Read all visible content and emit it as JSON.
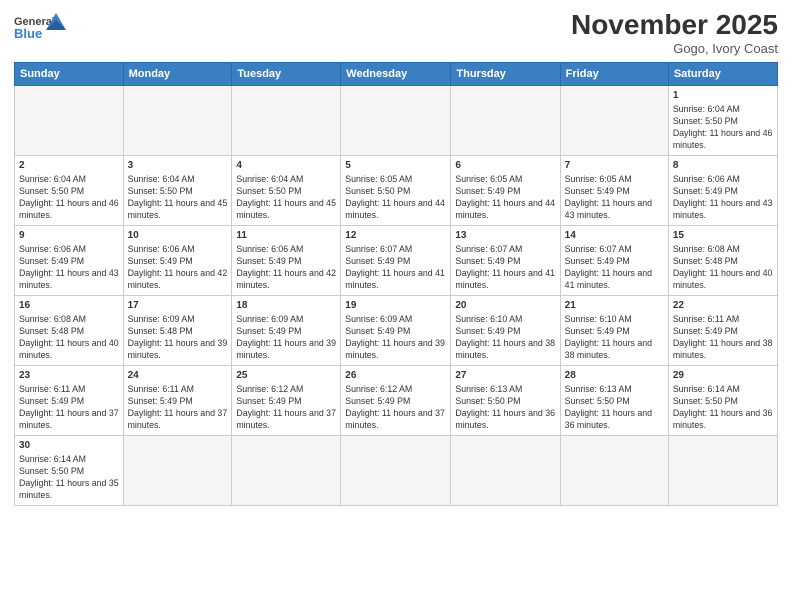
{
  "header": {
    "logo_general": "General",
    "logo_blue": "Blue",
    "month_title": "November 2025",
    "subtitle": "Gogo, Ivory Coast"
  },
  "weekdays": [
    "Sunday",
    "Monday",
    "Tuesday",
    "Wednesday",
    "Thursday",
    "Friday",
    "Saturday"
  ],
  "weeks": [
    [
      {
        "day": "",
        "empty": true
      },
      {
        "day": "",
        "empty": true
      },
      {
        "day": "",
        "empty": true
      },
      {
        "day": "",
        "empty": true
      },
      {
        "day": "",
        "empty": true
      },
      {
        "day": "",
        "empty": true
      },
      {
        "day": "1",
        "sunrise": "6:04 AM",
        "sunset": "5:50 PM",
        "daylight_h": "11",
        "daylight_m": "46"
      }
    ],
    [
      {
        "day": "2",
        "sunrise": "6:04 AM",
        "sunset": "5:50 PM",
        "daylight_h": "11",
        "daylight_m": "46"
      },
      {
        "day": "3",
        "sunrise": "6:04 AM",
        "sunset": "5:50 PM",
        "daylight_h": "11",
        "daylight_m": "45"
      },
      {
        "day": "4",
        "sunrise": "6:04 AM",
        "sunset": "5:50 PM",
        "daylight_h": "11",
        "daylight_m": "45"
      },
      {
        "day": "5",
        "sunrise": "6:05 AM",
        "sunset": "5:50 PM",
        "daylight_h": "11",
        "daylight_m": "44"
      },
      {
        "day": "6",
        "sunrise": "6:05 AM",
        "sunset": "5:49 PM",
        "daylight_h": "11",
        "daylight_m": "44"
      },
      {
        "day": "7",
        "sunrise": "6:05 AM",
        "sunset": "5:49 PM",
        "daylight_h": "11",
        "daylight_m": "43"
      },
      {
        "day": "8",
        "sunrise": "6:06 AM",
        "sunset": "5:49 PM",
        "daylight_h": "11",
        "daylight_m": "43"
      }
    ],
    [
      {
        "day": "9",
        "sunrise": "6:06 AM",
        "sunset": "5:49 PM",
        "daylight_h": "11",
        "daylight_m": "43"
      },
      {
        "day": "10",
        "sunrise": "6:06 AM",
        "sunset": "5:49 PM",
        "daylight_h": "11",
        "daylight_m": "42"
      },
      {
        "day": "11",
        "sunrise": "6:06 AM",
        "sunset": "5:49 PM",
        "daylight_h": "11",
        "daylight_m": "42"
      },
      {
        "day": "12",
        "sunrise": "6:07 AM",
        "sunset": "5:49 PM",
        "daylight_h": "11",
        "daylight_m": "41"
      },
      {
        "day": "13",
        "sunrise": "6:07 AM",
        "sunset": "5:49 PM",
        "daylight_h": "11",
        "daylight_m": "41"
      },
      {
        "day": "14",
        "sunrise": "6:07 AM",
        "sunset": "5:49 PM",
        "daylight_h": "11",
        "daylight_m": "41"
      },
      {
        "day": "15",
        "sunrise": "6:08 AM",
        "sunset": "5:48 PM",
        "daylight_h": "11",
        "daylight_m": "40"
      }
    ],
    [
      {
        "day": "16",
        "sunrise": "6:08 AM",
        "sunset": "5:48 PM",
        "daylight_h": "11",
        "daylight_m": "40"
      },
      {
        "day": "17",
        "sunrise": "6:09 AM",
        "sunset": "5:48 PM",
        "daylight_h": "11",
        "daylight_m": "39"
      },
      {
        "day": "18",
        "sunrise": "6:09 AM",
        "sunset": "5:49 PM",
        "daylight_h": "11",
        "daylight_m": "39"
      },
      {
        "day": "19",
        "sunrise": "6:09 AM",
        "sunset": "5:49 PM",
        "daylight_h": "11",
        "daylight_m": "39"
      },
      {
        "day": "20",
        "sunrise": "6:10 AM",
        "sunset": "5:49 PM",
        "daylight_h": "11",
        "daylight_m": "38"
      },
      {
        "day": "21",
        "sunrise": "6:10 AM",
        "sunset": "5:49 PM",
        "daylight_h": "11",
        "daylight_m": "38"
      },
      {
        "day": "22",
        "sunrise": "6:11 AM",
        "sunset": "5:49 PM",
        "daylight_h": "11",
        "daylight_m": "38"
      }
    ],
    [
      {
        "day": "23",
        "sunrise": "6:11 AM",
        "sunset": "5:49 PM",
        "daylight_h": "11",
        "daylight_m": "37"
      },
      {
        "day": "24",
        "sunrise": "6:11 AM",
        "sunset": "5:49 PM",
        "daylight_h": "11",
        "daylight_m": "37"
      },
      {
        "day": "25",
        "sunrise": "6:12 AM",
        "sunset": "5:49 PM",
        "daylight_h": "11",
        "daylight_m": "37"
      },
      {
        "day": "26",
        "sunrise": "6:12 AM",
        "sunset": "5:49 PM",
        "daylight_h": "11",
        "daylight_m": "37"
      },
      {
        "day": "27",
        "sunrise": "6:13 AM",
        "sunset": "5:50 PM",
        "daylight_h": "11",
        "daylight_m": "36"
      },
      {
        "day": "28",
        "sunrise": "6:13 AM",
        "sunset": "5:50 PM",
        "daylight_h": "11",
        "daylight_m": "36"
      },
      {
        "day": "29",
        "sunrise": "6:14 AM",
        "sunset": "5:50 PM",
        "daylight_h": "11",
        "daylight_m": "36"
      }
    ],
    [
      {
        "day": "30",
        "sunrise": "6:14 AM",
        "sunset": "5:50 PM",
        "daylight_h": "11",
        "daylight_m": "35"
      },
      {
        "day": "",
        "empty": true
      },
      {
        "day": "",
        "empty": true
      },
      {
        "day": "",
        "empty": true
      },
      {
        "day": "",
        "empty": true
      },
      {
        "day": "",
        "empty": true
      },
      {
        "day": "",
        "empty": true
      }
    ]
  ],
  "labels": {
    "sunrise": "Sunrise:",
    "sunset": "Sunset:",
    "daylight": "Daylight: {h} hours and {m} minutes."
  }
}
